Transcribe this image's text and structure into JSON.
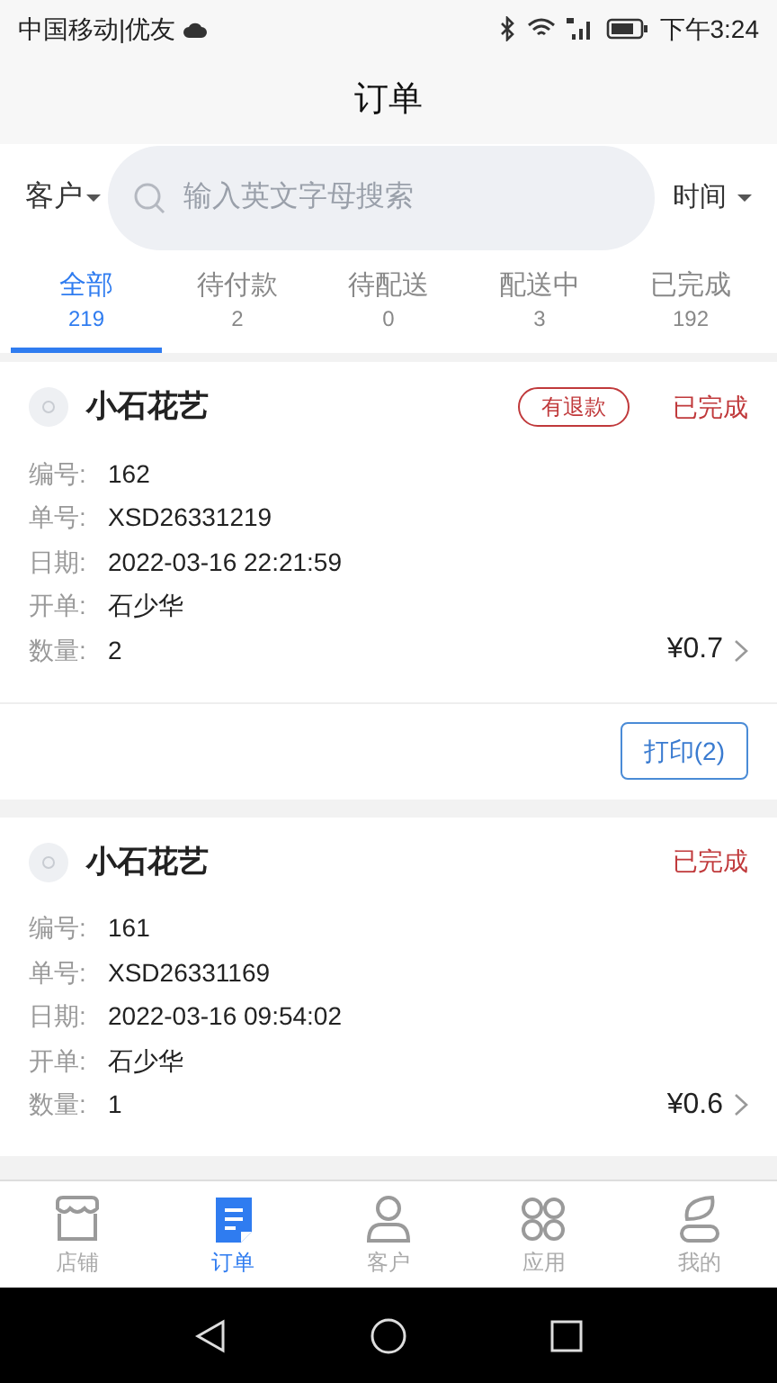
{
  "status_bar": {
    "carrier": "中国移动|优友",
    "time": "下午3:24"
  },
  "header": {
    "title": "订单"
  },
  "filters": {
    "customer": "客户",
    "search": {
      "placeholder": "输入英文字母搜索"
    },
    "time": "时间"
  },
  "tabs": [
    {
      "label": "全部",
      "count": "219",
      "selected": true
    },
    {
      "label": "待付款",
      "count": "2",
      "selected": false
    },
    {
      "label": "待配送",
      "count": "0",
      "selected": false
    },
    {
      "label": "配送中",
      "count": "3",
      "selected": false
    },
    {
      "label": "已完成",
      "count": "192",
      "selected": false
    }
  ],
  "orders": [
    {
      "shop": "小石花艺",
      "refund_badge": "有退款",
      "status": "已完成",
      "fields": [
        {
          "label": "编号:",
          "value": "162"
        },
        {
          "label": "单号:",
          "value": "XSD26331219"
        },
        {
          "label": "日期:",
          "value": "2022-03-16 22:21:59"
        },
        {
          "label": "开单:",
          "value": "石少华"
        },
        {
          "label": "数量:",
          "value": "2"
        }
      ],
      "amount": "¥0.7",
      "print_button": "打印(2)"
    },
    {
      "shop": "小石花艺",
      "status": "已完成",
      "fields": [
        {
          "label": "编号:",
          "value": "161"
        },
        {
          "label": "单号:",
          "value": "XSD26331169"
        },
        {
          "label": "日期:",
          "value": "2022-03-16 09:54:02"
        },
        {
          "label": "开单:",
          "value": "石少华"
        },
        {
          "label": "数量:",
          "value": "1"
        }
      ],
      "amount": "¥0.6"
    }
  ],
  "bottom_nav": [
    {
      "label": "店铺",
      "kind": "store",
      "selected": false
    },
    {
      "label": "订单",
      "kind": "order",
      "selected": true
    },
    {
      "label": "客户",
      "kind": "person",
      "selected": false
    },
    {
      "label": "应用",
      "kind": "apps",
      "selected": false
    },
    {
      "label": "我的",
      "kind": "me",
      "selected": false
    }
  ]
}
